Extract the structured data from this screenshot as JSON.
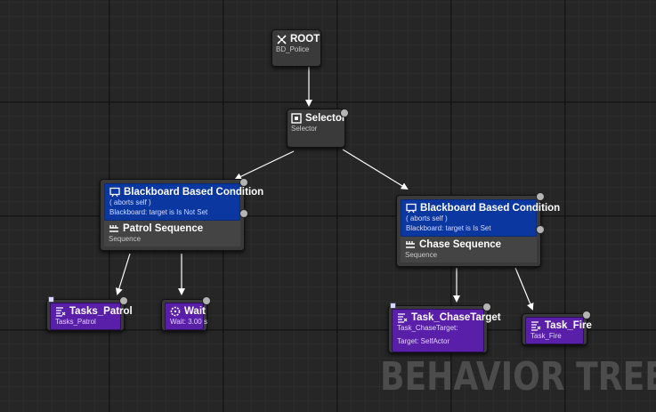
{
  "nodes": {
    "root": {
      "title": "ROOT",
      "subtitle": "BD_Police"
    },
    "selector": {
      "title": "Selector",
      "subtitle": "Selector"
    },
    "patrol": {
      "decorator": {
        "title": "Blackboard Based Condition",
        "line1": "( aborts self )",
        "line2": "Blackboard: target is Is Not Set"
      },
      "title": "Patrol Sequence",
      "subtitle": "Sequence"
    },
    "chase": {
      "decorator": {
        "title": "Blackboard Based Condition",
        "line1": "( aborts self )",
        "line2": "Blackboard: target is Is Set"
      },
      "title": "Chase Sequence",
      "subtitle": "Sequence"
    },
    "tasks_patrol": {
      "title": "Tasks_Patrol",
      "subtitle": "Tasks_Patrol"
    },
    "wait": {
      "title": "Wait",
      "subtitle": "Wait: 3.00 s"
    },
    "chase_target": {
      "title": "Task_ChaseTarget",
      "subtitle": "Task_ChaseTarget:",
      "detail": "Target: SelfActor"
    },
    "task_fire": {
      "title": "Task_Fire",
      "subtitle": "Task_Fire"
    }
  },
  "watermark": "BEHAVIOR TREE",
  "colors": {
    "decorator": "#0a37a0",
    "task": "#5a1fa8",
    "node": "#3a3a3a",
    "wire": "#ffffff"
  },
  "icons": {
    "root": "root-icon",
    "selector": "selector-icon",
    "decorator": "blackboard-icon",
    "sequence": "sequence-icon",
    "task": "task-icon",
    "wait": "wait-icon"
  }
}
